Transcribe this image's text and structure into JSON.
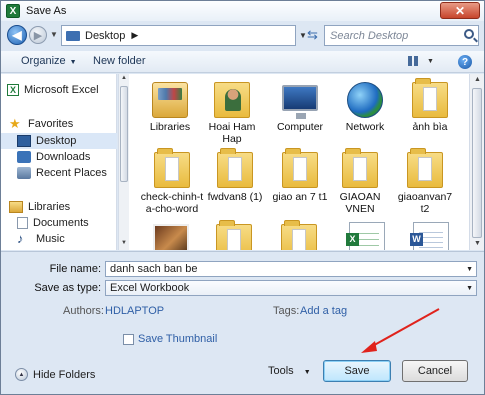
{
  "window": {
    "title": "Save As",
    "app_icon": "excel-icon"
  },
  "address": {
    "path": "Desktop",
    "search_placeholder": "Search Desktop"
  },
  "toolbar": {
    "organize": "Organize",
    "new_folder": "New folder"
  },
  "sidebar": {
    "items": [
      {
        "label": "Microsoft Excel",
        "icon": "excel-icon"
      },
      {
        "label": "Favorites",
        "icon": "star-icon"
      },
      {
        "label": "Desktop",
        "icon": "desktop-icon"
      },
      {
        "label": "Downloads",
        "icon": "downloads-icon"
      },
      {
        "label": "Recent Places",
        "icon": "recent-places-icon"
      },
      {
        "label": "Libraries",
        "icon": "libraries-icon"
      },
      {
        "label": "Documents",
        "icon": "documents-icon"
      },
      {
        "label": "Music",
        "icon": "music-icon"
      }
    ]
  },
  "files": [
    {
      "label": "Libraries",
      "icon": "libraries-icon"
    },
    {
      "label": "Hoai Ham Hap",
      "icon": "user-folder-icon"
    },
    {
      "label": "Computer",
      "icon": "computer-icon"
    },
    {
      "label": "Network",
      "icon": "network-icon"
    },
    {
      "label": "ảnh bìa",
      "icon": "folder-icon"
    },
    {
      "label": "check-chinh-ta-cho-word",
      "icon": "folder-icon"
    },
    {
      "label": "fwdvan8 (1)",
      "icon": "folder-icon"
    },
    {
      "label": "giao an 7 t1",
      "icon": "folder-icon"
    },
    {
      "label": "GIAOAN VNEN",
      "icon": "folder-icon"
    },
    {
      "label": "giaoanvan7 t2",
      "icon": "folder-icon"
    },
    {
      "label": "",
      "icon": "photo-icon"
    },
    {
      "label": "",
      "icon": "folder-icon"
    },
    {
      "label": "",
      "icon": "folder-icon"
    },
    {
      "label": "",
      "icon": "excel-file-icon"
    },
    {
      "label": "",
      "icon": "word-file-icon"
    }
  ],
  "form": {
    "file_name_label": "File name:",
    "file_name_value": "danh sach ban be",
    "save_type_label": "Save as type:",
    "save_type_value": "Excel Workbook",
    "authors_label": "Authors:",
    "authors_value": "HDLAPTOP",
    "tags_label": "Tags:",
    "tags_value": "Add a tag",
    "thumbnail_label": "Save Thumbnail"
  },
  "footer": {
    "hide_folders": "Hide Folders",
    "tools": "Tools",
    "save": "Save",
    "cancel": "Cancel"
  },
  "colors": {
    "annotation_arrow": "#e0231c",
    "accent": "#2f5fa6"
  }
}
